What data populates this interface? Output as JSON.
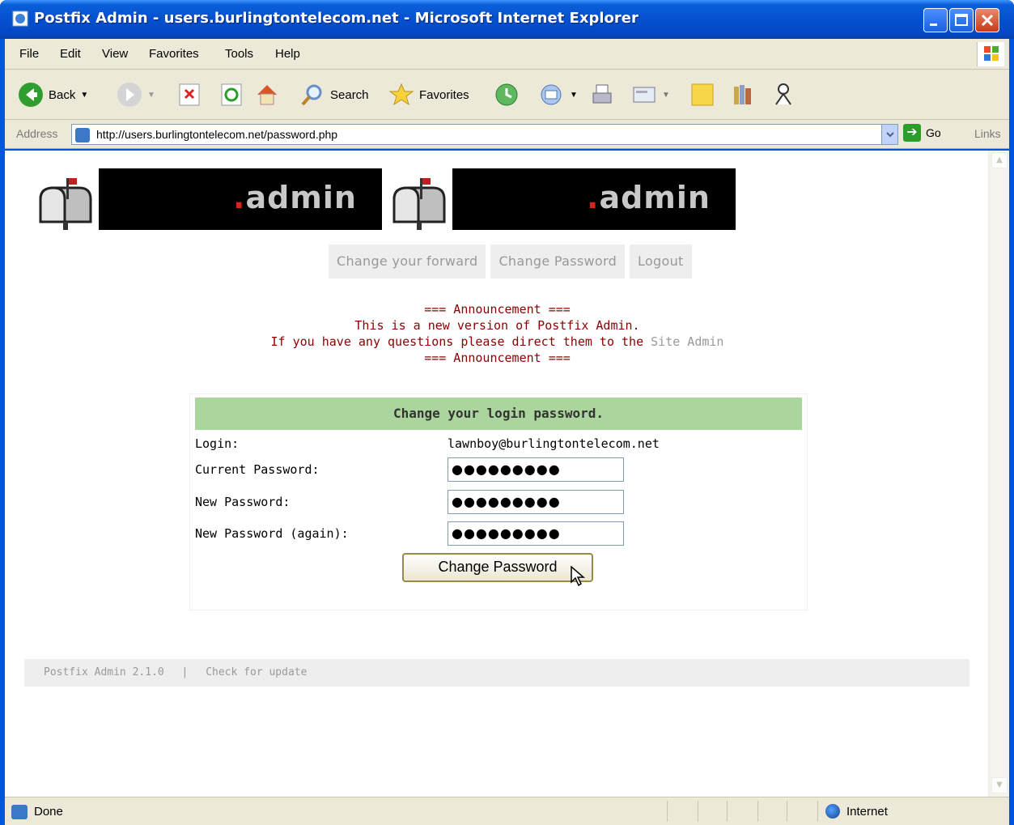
{
  "window": {
    "title": "Postfix Admin - users.burlingtontelecom.net - Microsoft Internet Explorer"
  },
  "menubar": {
    "items": [
      "File",
      "Edit",
      "View",
      "Favorites",
      "Tools",
      "Help"
    ]
  },
  "toolbar": {
    "back_label": "Back",
    "search_label": "Search",
    "favorites_label": "Favorites"
  },
  "addressbar": {
    "label": "Address",
    "url": "http://users.burlingtontelecom.net/password.php",
    "go_label": "Go",
    "links_label": "Links"
  },
  "page": {
    "logo_text": "admin",
    "nav": {
      "forward": "Change your forward",
      "password": "Change Password",
      "logout": "Logout"
    },
    "announcement": {
      "line1": "=== Announcement ===",
      "line2": "This is a new version of Postfix Admin.",
      "line3_prefix": "If you have any questions please direct them to the",
      "line3_link": "Site Admin",
      "line4": "=== Announcement ==="
    },
    "form": {
      "heading": "Change your login password.",
      "login_label": "Login:",
      "login_value": "lawnboy@burlingtontelecom.net",
      "current_label": "Current Password:",
      "current_value": "●●●●●●●●●",
      "new_label": "New Password:",
      "new_value": "●●●●●●●●●",
      "again_label": "New Password (again):",
      "again_value": "●●●●●●●●●",
      "submit_label": "Change Password"
    },
    "footer": {
      "version": "Postfix Admin 2.1.0",
      "separator": "|",
      "update": "Check for update"
    }
  },
  "statusbar": {
    "status": "Done",
    "zone": "Internet"
  }
}
